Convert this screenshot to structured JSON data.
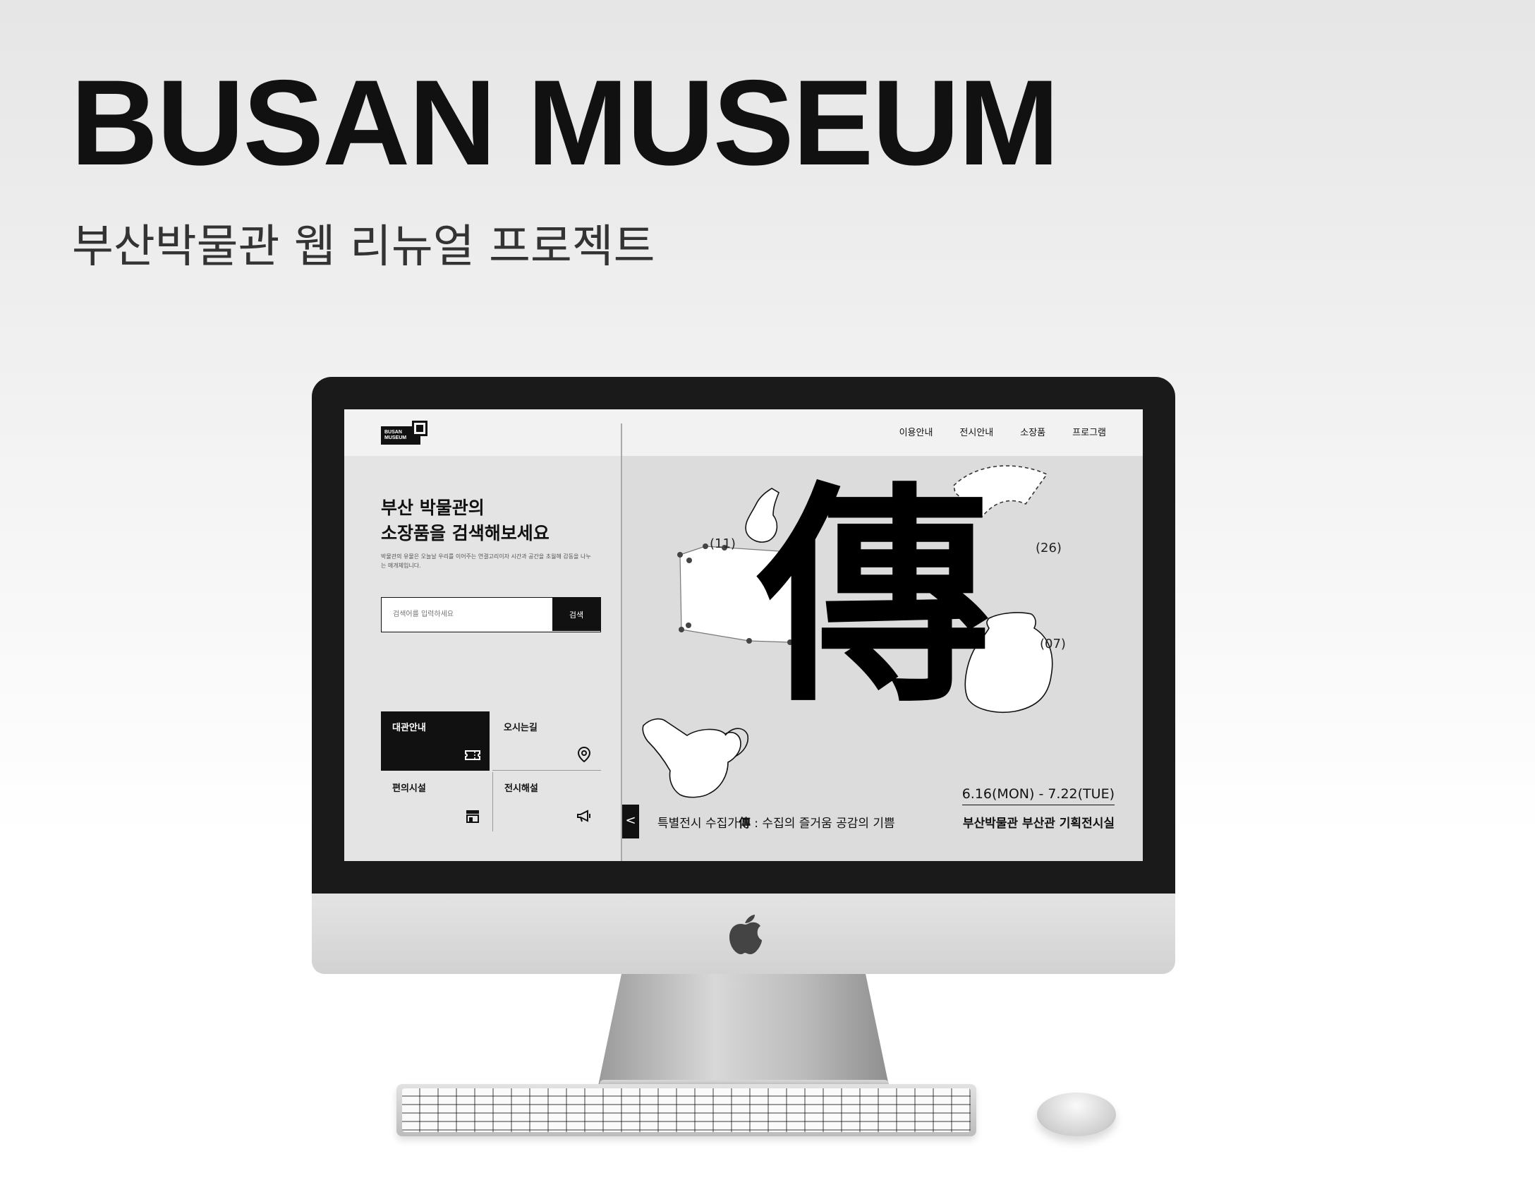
{
  "hero": {
    "title": "BUSAN MUSEUM",
    "subtitle": "부산박물관 웹 리뉴얼 프로젝트"
  },
  "site": {
    "logo_text": "BUSAN MUSEUM",
    "nav": [
      "이용안내",
      "전시안내",
      "소장품",
      "프로그램"
    ],
    "search": {
      "headline_line1": "부산 박물관의",
      "headline_line2": "소장품을 검색해보세요",
      "description": "박물관의 유물은 오늘날 우리를 이어주는 연결고리이자 시간과 공간을 초월해 감동을 나누는 매개체입니다.",
      "placeholder": "검색어를 입력하세요",
      "button_label": "검색"
    },
    "quick_links": [
      {
        "label": "대관안내",
        "icon": "ticket-icon"
      },
      {
        "label": "오시는길",
        "icon": "location-pin-icon"
      },
      {
        "label": "편의시설",
        "icon": "store-icon"
      },
      {
        "label": "전시해설",
        "icon": "megaphone-icon"
      }
    ],
    "exhibition": {
      "hanja": "傳",
      "numbers": [
        "(11)",
        "(26)",
        "(07)"
      ],
      "title_prefix": "특별전시  수집가",
      "title_hanja": "傳",
      "title_suffix": " : 수집의 즐거움 공감의 기쁨",
      "dates": "6.16(MON) - 7.22(TUE)",
      "location": "부산박물관 부산관 기획전시실",
      "prev_label": "<"
    }
  },
  "colors": {
    "ink": "#111111",
    "screen_bg": "#dcdcdc",
    "panel_bg": "#e4e4e4",
    "header_bg": "#f2f2f2"
  }
}
